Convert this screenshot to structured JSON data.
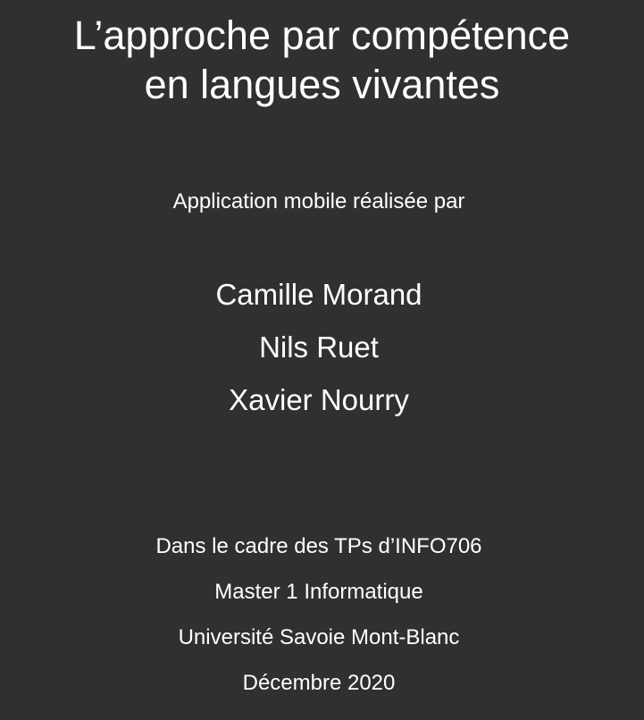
{
  "title": {
    "line1": "L’approche par compétence",
    "line2": "en langues vivantes"
  },
  "subtitle": "Application mobile réalisée par",
  "authors": [
    "Camille Morand",
    "Nils Ruet",
    "Xavier Nourry"
  ],
  "footer": [
    "Dans le cadre des TPs d’INFO706",
    "Master 1 Informatique",
    "Université Savoie Mont-Blanc",
    "Décembre 2020"
  ],
  "colors": {
    "background": "#303030",
    "text": "#ffffff"
  }
}
